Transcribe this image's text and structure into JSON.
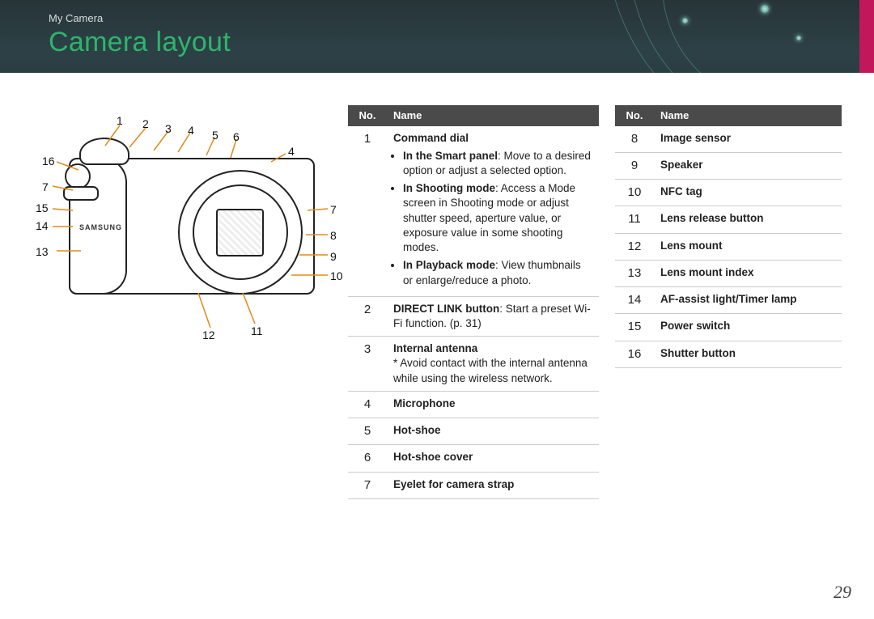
{
  "breadcrumb": "My Camera",
  "page_title": "Camera layout",
  "page_number": "29",
  "table_header": {
    "no": "No.",
    "name": "Name"
  },
  "diagram": {
    "callouts": [
      "1",
      "2",
      "3",
      "4",
      "5",
      "6",
      "7",
      "8",
      "9",
      "10",
      "11",
      "12",
      "13",
      "14",
      "15",
      "16",
      "4",
      "7"
    ],
    "logo": "SAMSUNG"
  },
  "table1": [
    {
      "no": "1",
      "title": "Command dial",
      "bullets": [
        {
          "lead": "In the Smart panel",
          "rest": ": Move to a desired option or adjust a selected option."
        },
        {
          "lead": "In Shooting mode",
          "rest": ": Access a Mode screen in Shooting mode or adjust shutter speed, aperture value, or exposure value in some shooting modes."
        },
        {
          "lead": "In Playback mode",
          "rest": ": View thumbnails or enlarge/reduce a photo."
        }
      ]
    },
    {
      "no": "2",
      "title_inline_lead": "DIRECT LINK button",
      "title_inline_rest": ": Start a preset Wi-Fi function. (p. 31)"
    },
    {
      "no": "3",
      "title": "Internal antenna",
      "note": "* Avoid contact with the internal antenna while using the wireless network."
    },
    {
      "no": "4",
      "title": "Microphone"
    },
    {
      "no": "5",
      "title": "Hot-shoe"
    },
    {
      "no": "6",
      "title": "Hot-shoe cover"
    },
    {
      "no": "7",
      "title": "Eyelet for camera strap"
    }
  ],
  "table2": [
    {
      "no": "8",
      "title": "Image sensor"
    },
    {
      "no": "9",
      "title": "Speaker"
    },
    {
      "no": "10",
      "title": "NFC tag"
    },
    {
      "no": "11",
      "title": "Lens release button"
    },
    {
      "no": "12",
      "title": "Lens mount"
    },
    {
      "no": "13",
      "title": "Lens mount index"
    },
    {
      "no": "14",
      "title": "AF-assist light/Timer lamp"
    },
    {
      "no": "15",
      "title": "Power switch"
    },
    {
      "no": "16",
      "title": "Shutter button"
    }
  ]
}
